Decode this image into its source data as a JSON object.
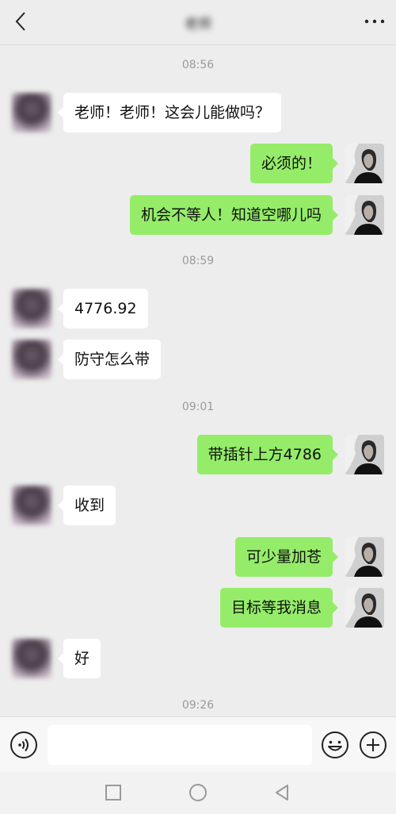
{
  "header": {
    "title": "老师",
    "back_icon": "chevron-left-icon",
    "more_icon": "more-horizontal-icon"
  },
  "messages": [
    {
      "type": "time",
      "text": "08:56"
    },
    {
      "type": "msg",
      "side": "left",
      "text": "老师！老师！这会儿能做吗？"
    },
    {
      "type": "msg",
      "side": "right",
      "text": "必须的！"
    },
    {
      "type": "msg",
      "side": "right",
      "text": "机会不等人！知道空哪儿吗"
    },
    {
      "type": "time",
      "text": "08:59"
    },
    {
      "type": "msg",
      "side": "left",
      "text": "4776.92"
    },
    {
      "type": "msg",
      "side": "left",
      "text": "防守怎么带"
    },
    {
      "type": "time",
      "text": "09:01"
    },
    {
      "type": "msg",
      "side": "right",
      "text": "带插针上方4786"
    },
    {
      "type": "msg",
      "side": "left",
      "text": "收到"
    },
    {
      "type": "msg",
      "side": "right",
      "text": "可少量加苍"
    },
    {
      "type": "msg",
      "side": "right",
      "text": "目标等我消息"
    },
    {
      "type": "msg",
      "side": "left",
      "text": "好"
    },
    {
      "type": "time",
      "text": "09:26"
    }
  ],
  "input_bar": {
    "value": "",
    "placeholder": "",
    "voice_icon": "voice-icon",
    "emoji_icon": "emoji-icon",
    "plus_icon": "plus-icon"
  },
  "colors": {
    "background": "#ededed",
    "sent_bubble": "#95ec69",
    "received_bubble": "#ffffff"
  }
}
